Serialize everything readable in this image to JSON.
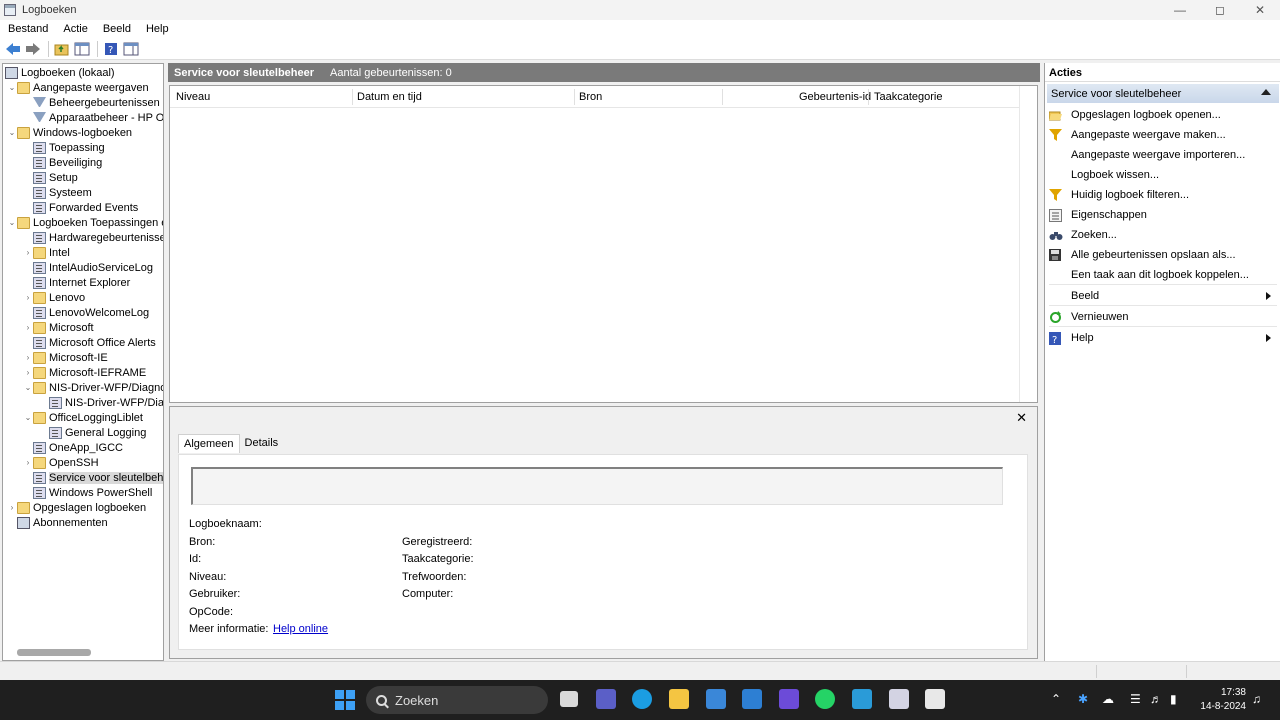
{
  "window": {
    "title": "Logboeken"
  },
  "menu": [
    "Bestand",
    "Actie",
    "Beeld",
    "Help"
  ],
  "tree": {
    "items": [
      {
        "label": "Logboeken (lokaal)",
        "level": 0,
        "icon": "computer-log-icon",
        "expander": ""
      },
      {
        "label": "Aangepaste weergaven",
        "level": 1,
        "icon": "folder-icon",
        "expander": "expanded"
      },
      {
        "label": "Beheergebeurtenissen",
        "level": 2,
        "icon": "filter-icon",
        "expander": ""
      },
      {
        "label": "Apparaatbeheer - HP Office",
        "level": 2,
        "icon": "filter-icon",
        "expander": ""
      },
      {
        "label": "Windows-logboeken",
        "level": 1,
        "icon": "folder-icon",
        "expander": "expanded"
      },
      {
        "label": "Toepassing",
        "level": 2,
        "icon": "log-icon",
        "expander": ""
      },
      {
        "label": "Beveiliging",
        "level": 2,
        "icon": "log-icon",
        "expander": ""
      },
      {
        "label": "Setup",
        "level": 2,
        "icon": "log-icon",
        "expander": ""
      },
      {
        "label": "Systeem",
        "level": 2,
        "icon": "log-icon",
        "expander": ""
      },
      {
        "label": "Forwarded Events",
        "level": 2,
        "icon": "log-icon",
        "expander": ""
      },
      {
        "label": "Logboeken Toepassingen en",
        "level": 1,
        "icon": "folder-icon",
        "expander": "expanded"
      },
      {
        "label": "Hardwaregebeurtenissen",
        "level": 2,
        "icon": "log-icon",
        "expander": ""
      },
      {
        "label": "Intel",
        "level": 2,
        "icon": "folder-icon",
        "expander": "collapsed"
      },
      {
        "label": "IntelAudioServiceLog",
        "level": 2,
        "icon": "log-icon",
        "expander": ""
      },
      {
        "label": "Internet Explorer",
        "level": 2,
        "icon": "log-icon",
        "expander": ""
      },
      {
        "label": "Lenovo",
        "level": 2,
        "icon": "folder-icon",
        "expander": "collapsed"
      },
      {
        "label": "LenovoWelcomeLog",
        "level": 2,
        "icon": "log-icon",
        "expander": ""
      },
      {
        "label": "Microsoft",
        "level": 2,
        "icon": "folder-icon",
        "expander": "collapsed"
      },
      {
        "label": "Microsoft Office Alerts",
        "level": 2,
        "icon": "log-icon",
        "expander": ""
      },
      {
        "label": "Microsoft-IE",
        "level": 2,
        "icon": "folder-icon",
        "expander": "collapsed"
      },
      {
        "label": "Microsoft-IEFRAME",
        "level": 2,
        "icon": "folder-icon",
        "expander": "collapsed"
      },
      {
        "label": "NIS-Driver-WFP/Diagnostic",
        "level": 2,
        "icon": "folder-icon",
        "expander": "expanded"
      },
      {
        "label": "NIS-Driver-WFP/Diagnostic",
        "level": 3,
        "icon": "log-icon",
        "expander": ""
      },
      {
        "label": "OfficeLoggingLiblet",
        "level": 2,
        "icon": "folder-icon",
        "expander": "expanded"
      },
      {
        "label": "General Logging",
        "level": 3,
        "icon": "log-icon",
        "expander": ""
      },
      {
        "label": "OneApp_IGCC",
        "level": 2,
        "icon": "log-icon",
        "expander": ""
      },
      {
        "label": "OpenSSH",
        "level": 2,
        "icon": "folder-icon",
        "expander": "collapsed"
      },
      {
        "label": "Service voor sleutelbeheer",
        "level": 2,
        "icon": "log-icon",
        "expander": "",
        "selected": true
      },
      {
        "label": "Windows PowerShell",
        "level": 2,
        "icon": "log-icon",
        "expander": ""
      },
      {
        "label": "Opgeslagen logboeken",
        "level": 1,
        "icon": "folder-icon",
        "expander": "collapsed"
      },
      {
        "label": "Abonnementen",
        "level": 1,
        "icon": "subscription-icon",
        "expander": ""
      }
    ]
  },
  "center": {
    "title": "Service voor sleutelbeheer",
    "count": "Aantal gebeurtenissen: 0",
    "columns": [
      "Niveau",
      "Datum en tijd",
      "Bron",
      "Gebeurtenis-id",
      "Taakcategorie"
    ]
  },
  "detail": {
    "tabs": [
      "Algemeen",
      "Details"
    ],
    "fields": {
      "logname": "Logboeknaam:",
      "source": "Bron:",
      "id": "Id:",
      "level": "Niveau:",
      "user": "Gebruiker:",
      "opcode": "OpCode:",
      "moreinfo": "Meer informatie:",
      "helplink": "Help online",
      "logged": "Geregistreerd:",
      "taskcat": "Taakcategorie:",
      "keywords": "Trefwoorden:",
      "computer": "Computer:"
    }
  },
  "actions": {
    "header": "Acties",
    "section": "Service voor sleutelbeheer",
    "items": [
      {
        "label": "Opgeslagen logboek openen...",
        "icon": "open-folder-icon"
      },
      {
        "label": "Aangepaste weergave maken...",
        "icon": "filter-icon"
      },
      {
        "label": "Aangepaste weergave importeren...",
        "icon": ""
      },
      {
        "label": "Logboek wissen...",
        "icon": ""
      },
      {
        "label": "Huidig logboek filteren...",
        "icon": "filter-icon"
      },
      {
        "label": "Eigenschappen",
        "icon": "properties-icon"
      },
      {
        "label": "Zoeken...",
        "icon": "binoculars-icon"
      },
      {
        "label": "Alle gebeurtenissen opslaan als...",
        "icon": "save-icon"
      },
      {
        "label": "Een taak aan dit logboek koppelen...",
        "icon": ""
      },
      {
        "label": "Beeld",
        "icon": "",
        "submenu": true
      },
      {
        "label": "Vernieuwen",
        "icon": "refresh-icon"
      },
      {
        "label": "Help",
        "icon": "help-icon",
        "submenu": true
      }
    ]
  },
  "taskbar": {
    "search_placeholder": "Zoeken",
    "time": "17:38",
    "date": "14-8-2024"
  }
}
